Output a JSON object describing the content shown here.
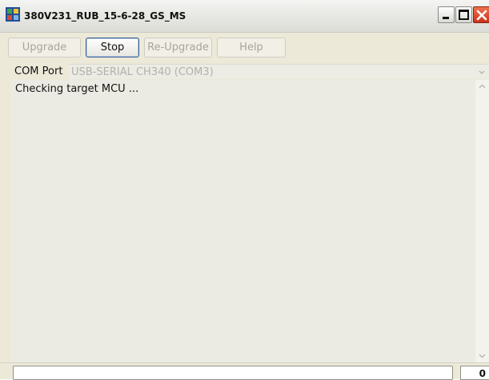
{
  "window": {
    "title": "380V231_RUB_15-6-28_GS_MS",
    "controls": [
      "minimize-icon",
      "maximize-icon",
      "close-icon"
    ]
  },
  "toolbar": {
    "upgrade_label": "Upgrade",
    "stop_label": "Stop",
    "reupgrade_label": "Re-Upgrade",
    "help_label": "Help"
  },
  "com_port": {
    "label": "COM Port",
    "selected": "USB-SERIAL CH340 (COM3)"
  },
  "log": {
    "lines": [
      "Checking target MCU ..."
    ]
  },
  "status": {
    "message": "",
    "count": "0"
  },
  "colors": {
    "close_red": "#d8452a",
    "window_bg": "#ece9d8",
    "disabled_text": "#a6a69b"
  }
}
